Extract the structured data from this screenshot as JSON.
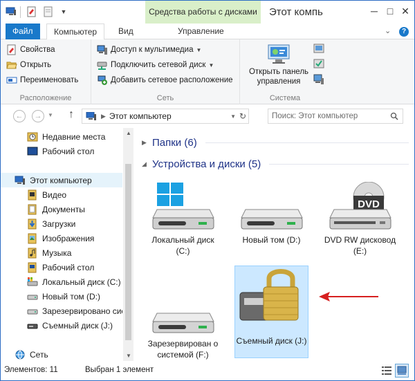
{
  "window": {
    "title": "Этот компь",
    "context_tab_header": "Средства работы с дисками",
    "accent_color": "#1979ca",
    "context_color": "#d9efc9"
  },
  "tabs": {
    "file": "Файл",
    "computer": "Компьютер",
    "view": "Вид",
    "manage": "Управление",
    "help": "?"
  },
  "ribbon": {
    "location": {
      "label": "Расположение",
      "items": [
        "Свойства",
        "Открыть",
        "Переименовать"
      ]
    },
    "network": {
      "label": "Сеть",
      "items": [
        "Доступ к мультимедиа",
        "Подключить сетевой диск",
        "Добавить сетевое расположение"
      ]
    },
    "system": {
      "label": "Система",
      "control_panel": "Открыть панель управления"
    }
  },
  "address": {
    "path": "Этот компьютер",
    "search_placeholder": "Поиск: Этот компьютер"
  },
  "nav": {
    "items": [
      {
        "label": "Недавние места",
        "icon": "recent-places-icon"
      },
      {
        "label": "Рабочий стол",
        "icon": "desktop-icon"
      },
      {
        "label": "Этот компьютер",
        "icon": "computer-icon"
      },
      {
        "label": "Видео",
        "icon": "video-library-icon"
      },
      {
        "label": "Документы",
        "icon": "documents-library-icon"
      },
      {
        "label": "Загрузки",
        "icon": "downloads-icon"
      },
      {
        "label": "Изображения",
        "icon": "pictures-library-icon"
      },
      {
        "label": "Музыка",
        "icon": "music-library-icon"
      },
      {
        "label": "Рабочий стол",
        "icon": "desktop-folder-icon"
      },
      {
        "label": "Локальный диск (C:)",
        "icon": "system-drive-icon"
      },
      {
        "label": "Новый том (D:)",
        "icon": "drive-icon"
      },
      {
        "label": "Зарезервировано системой",
        "icon": "drive-icon"
      },
      {
        "label": "Съемный диск (J:)",
        "icon": "removable-drive-icon"
      },
      {
        "label": "Сеть",
        "icon": "network-icon"
      }
    ]
  },
  "content": {
    "folders_group": "Папки (6)",
    "devices_group": "Устройства и диски (5)",
    "drives": [
      {
        "label": "Локальный диск (C:)",
        "icon": "windows-drive-icon"
      },
      {
        "label": "Новый том (D:)",
        "icon": "hard-drive-icon"
      },
      {
        "label": "DVD RW дисковод (E:)",
        "icon": "dvd-drive-icon",
        "badge": "DVD"
      },
      {
        "label": "Зарезервирован о системой (F:)",
        "icon": "hard-drive-icon"
      },
      {
        "label": "Съемный диск (J:)",
        "icon": "locked-drive-icon"
      }
    ]
  },
  "status": {
    "items_count": "Элементов: 11",
    "selected": "Выбран 1 элемент"
  }
}
